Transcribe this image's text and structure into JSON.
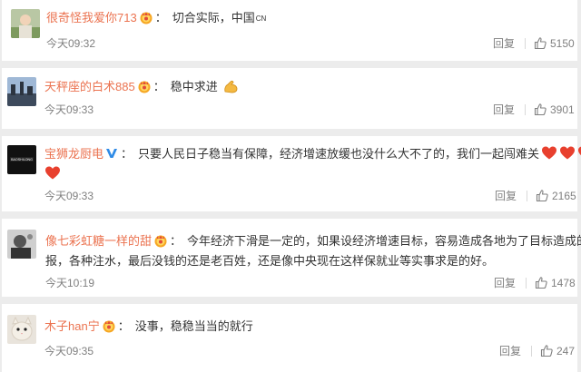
{
  "comments": [
    {
      "username": "很奇怪我爱你713",
      "text": "切合实际，中国",
      "flag_text": "CN",
      "time": "今天09:32",
      "reply_label": "回复",
      "likes": "5150"
    },
    {
      "username": "天秤座的白术885",
      "text": "稳中求进",
      "time": "今天09:33",
      "reply_label": "回复",
      "likes": "3901"
    },
    {
      "username": "宝狮龙厨电",
      "text_line1": "只要人民日子稳当有保障，经济增速放缓也没什么大不了的，我们一起闯难关",
      "time": "今天09:33",
      "reply_label": "回复",
      "likes": "2165",
      "avatar_text": "BAOSHILONG"
    },
    {
      "username": "像七彩虹糖一样的甜",
      "text_line1": "今年经济下滑是一定的，如果设经济增速目标，容易造成各地为了目标造成的虚",
      "text_line2": "报，各种注水，最后没钱的还是老百姓，还是像中央现在这样保就业等实事求是的好。",
      "time": "今天10:19",
      "reply_label": "回复",
      "likes": "1478"
    },
    {
      "username": "木子han宁",
      "text": "没事，稳稳当当的就行",
      "time": "今天09:35",
      "reply_label": "回复",
      "likes": "247"
    }
  ],
  "colors": {
    "username": "#eb7350",
    "text": "#333333",
    "meta": "#808080",
    "background": "#ececec",
    "card": "#ffffff"
  },
  "icons": [
    "crown-medal-icon",
    "verified-v-icon",
    "thumbs-up-icon",
    "heart-emoji-icon",
    "flexed-biceps-emoji-icon"
  ]
}
